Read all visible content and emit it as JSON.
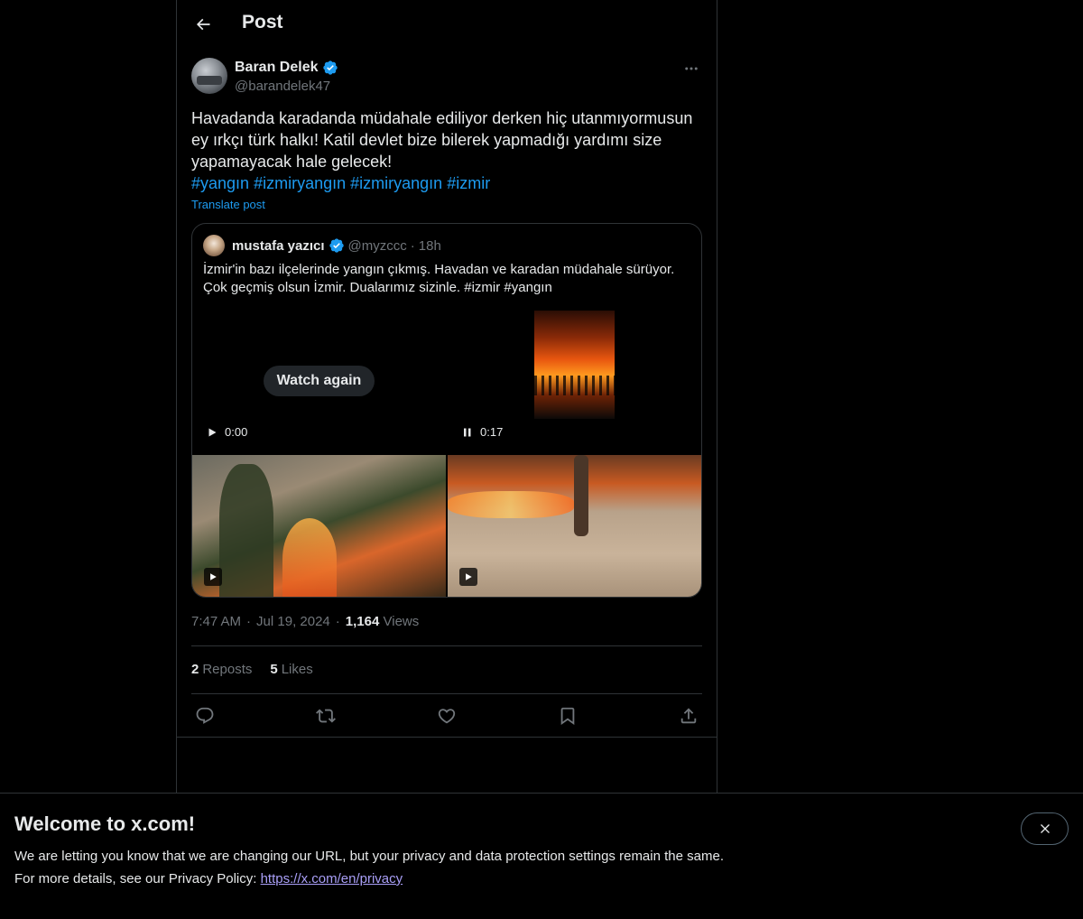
{
  "header": {
    "title": "Post"
  },
  "post": {
    "author_name": "Baran Delek",
    "author_handle": "@barandelek47",
    "text": "Havadanda karadanda müdahale ediliyor derken hiç utanmıyormusun ey ırkçı türk halkı! Katil devlet bize bilerek yapmadığı yardımı size yapamayacak hale gelecek!",
    "hashtags": [
      "#yangın",
      "#izmiryangın",
      "#izmiryangın",
      "#izmir"
    ],
    "translate_label": "Translate post",
    "time": "7:47 AM",
    "date": "Jul 19, 2024",
    "views_count": "1,164",
    "views_label": "Views",
    "reposts_count": "2",
    "reposts_label": "Reposts",
    "likes_count": "5",
    "likes_label": "Likes"
  },
  "quote": {
    "name": "mustafa yazıcı",
    "handle": "@myzccc",
    "separator": "·",
    "time": "18h",
    "text": "İzmir'in bazı ilçelerinde yangın çıkmış. Havadan ve karadan müdahale sürüyor. Çok geçmiş olsun İzmir. Dualarımız sizinle. #izmir #yangın",
    "watch_again": "Watch again",
    "video1_time": "0:00",
    "video2_time": "0:17"
  },
  "banner": {
    "title": "Welcome to x.com!",
    "line1": "We are letting you know that we are changing our URL, but your privacy and data protection settings remain the same.",
    "line2_prefix": "For more details, see our Privacy Policy: ",
    "link": "https://x.com/en/privacy"
  },
  "colors": {
    "accent": "#1d9bf0",
    "text": "#e7e9ea",
    "muted": "#71767b",
    "border": "#2f3336",
    "link": "#a99ff7"
  }
}
